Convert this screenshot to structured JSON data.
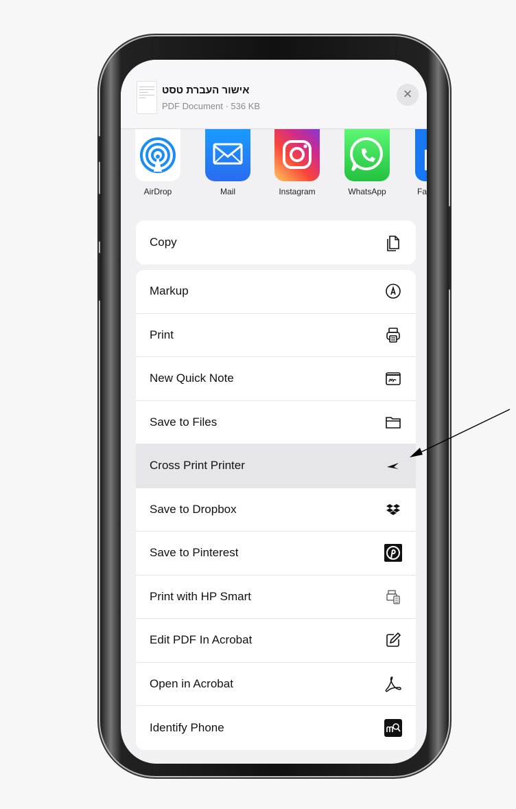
{
  "share_sheet": {
    "document": {
      "title": "אישור העברת טסט",
      "subtitle": "PDF Document · 536 KB"
    },
    "close_symbol": "×",
    "apps": [
      {
        "label": "AirDrop",
        "icon": "airdrop-icon"
      },
      {
        "label": "Mail",
        "icon": "mail-icon"
      },
      {
        "label": "Instagram",
        "icon": "instagram-icon"
      },
      {
        "label": "WhatsApp",
        "icon": "whatsapp-icon"
      },
      {
        "label": "Fa",
        "icon": "facebook-icon"
      }
    ],
    "copy_group": [
      {
        "label": "Copy",
        "icon": "copy-icon"
      }
    ],
    "actions": [
      {
        "label": "Markup",
        "icon": "markup-icon"
      },
      {
        "label": "Print",
        "icon": "print-icon"
      },
      {
        "label": "New Quick Note",
        "icon": "quick-note-icon"
      },
      {
        "label": "Save to Files",
        "icon": "folder-icon"
      },
      {
        "label": "Cross Print Printer",
        "icon": "cross-print-icon",
        "highlighted": true
      },
      {
        "label": "Save to Dropbox",
        "icon": "dropbox-icon"
      },
      {
        "label": "Save to Pinterest",
        "icon": "pinterest-icon"
      },
      {
        "label": "Print with HP Smart",
        "icon": "hp-smart-icon"
      },
      {
        "label": "Edit PDF In Acrobat",
        "icon": "edit-pdf-icon"
      },
      {
        "label": "Open in Acrobat",
        "icon": "acrobat-icon"
      },
      {
        "label": "Identify Phone",
        "icon": "identify-phone-icon"
      }
    ]
  },
  "colors": {
    "highlight": "#e6e6ea",
    "mail": "#2f8cf7",
    "whatsapp": "#2fd158"
  }
}
